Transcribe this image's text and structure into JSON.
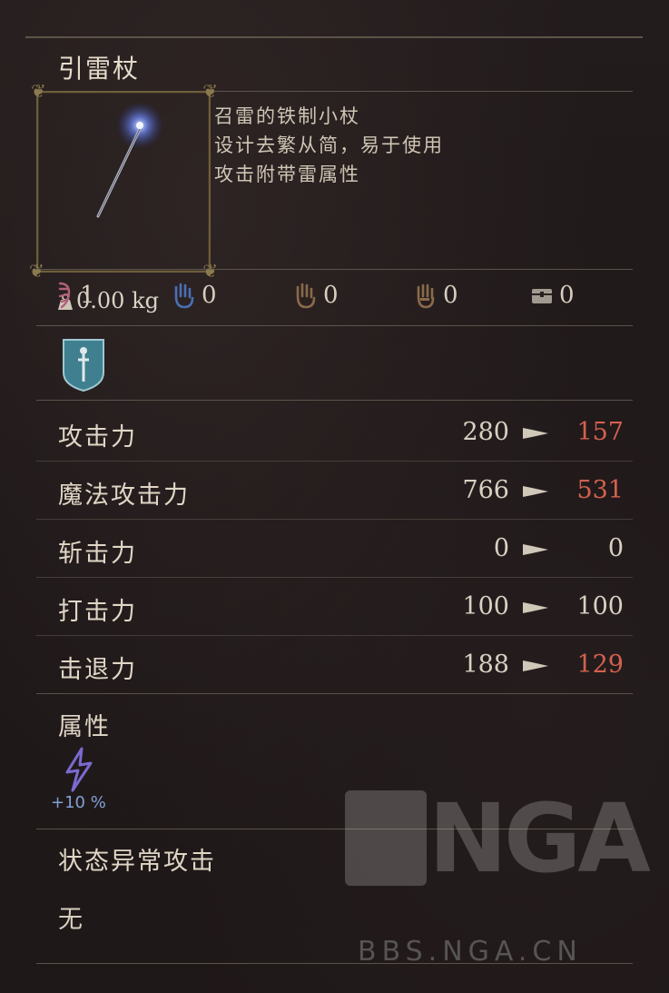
{
  "item": {
    "name": "引雷杖",
    "weight": "0.00 kg",
    "description": [
      "召雷的铁制小杖",
      "设计去繁从简，易于使用",
      "攻击附带雷属性"
    ]
  },
  "requirements": [
    {
      "icon": "strength-rune-icon",
      "value": "1",
      "color": "#b0607a"
    },
    {
      "icon": "magic-hand-icon",
      "value": "0",
      "color": "#4a6fb5"
    },
    {
      "icon": "hand-icon",
      "value": "0",
      "color": "#8a6a4a"
    },
    {
      "icon": "gauntlet-icon",
      "value": "0",
      "color": "#8a6a4a"
    },
    {
      "icon": "chest-icon",
      "value": "0",
      "color": "#a09a90"
    }
  ],
  "stats": [
    {
      "label": "攻击力",
      "current": "280",
      "new": "157",
      "new_color": "#d2614f"
    },
    {
      "label": "魔法攻击力",
      "current": "766",
      "new": "531",
      "new_color": "#d2614f"
    },
    {
      "label": "斩击力",
      "current": "0",
      "new": "0",
      "new_color": "#d8d0c2"
    },
    {
      "label": "打击力",
      "current": "100",
      "new": "100",
      "new_color": "#d8d0c2"
    },
    {
      "label": "击退力",
      "current": "188",
      "new": "129",
      "new_color": "#d2614f"
    }
  ],
  "attribute": {
    "label": "属性",
    "element": "thunder-bolt-icon",
    "bonus": "+10 %"
  },
  "status_attack": {
    "label": "状态异常攻击",
    "value": "无"
  },
  "watermark": {
    "logo": "NGA",
    "url": "BBS.NGA.CN"
  }
}
